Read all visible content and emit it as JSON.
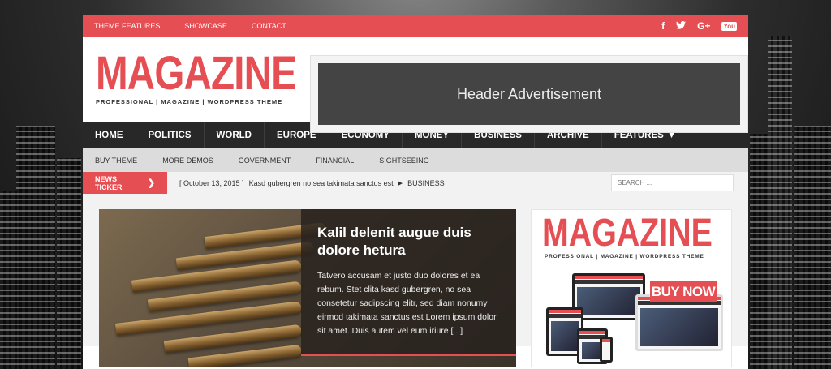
{
  "topbar": {
    "links": [
      "THEME FEATURES",
      "SHOWCASE",
      "CONTACT"
    ],
    "social": [
      {
        "icon": "facebook-icon",
        "glyph": "f"
      },
      {
        "icon": "twitter-icon",
        "glyph": "🐦"
      },
      {
        "icon": "google-plus-icon",
        "glyph": "G+"
      },
      {
        "icon": "youtube-icon",
        "glyph": "You"
      }
    ]
  },
  "header": {
    "logo_title": "MAGAZINE",
    "logo_tagline": "PROFESSIONAL | MAGAZINE | WORDPRESS THEME",
    "ad_text": "Header Advertisement"
  },
  "main_nav": [
    "HOME",
    "POLITICS",
    "WORLD",
    "EUROPE",
    "ECONOMY",
    "MONEY",
    "BUSINESS",
    "ARCHIVE",
    "FEATURES"
  ],
  "sub_nav": [
    "BUY THEME",
    "MORE DEMOS",
    "GOVERNMENT",
    "FINANCIAL",
    "SIGHTSEEING"
  ],
  "ticker": {
    "label": "NEWS TICKER",
    "date": "[ October 13, 2015 ]",
    "headline": "Kasd gubergren no sea takimata sanctus est",
    "category": "BUSINESS"
  },
  "search": {
    "placeholder": "SEARCH ..."
  },
  "featured": {
    "title": "Kalil delenit augue duis dolore hetura",
    "excerpt": "Tatvero accusam et justo duo dolores et ea rebum. Stet clita kasd gubergren, no sea consetetur sadipscing elitr, sed diam nonumy eirmod takimata sanctus est Lorem ipsum dolor sit amet. Duis autem vel eum iriure [...]"
  },
  "sidebar_ad": {
    "logo_title": "MAGAZINE",
    "logo_tagline": "PROFESSIONAL | MAGAZINE | WORDPRESS THEME",
    "cta": "BUY NOW"
  },
  "colors": {
    "accent": "#e54e53",
    "nav_dark": "#282828"
  }
}
